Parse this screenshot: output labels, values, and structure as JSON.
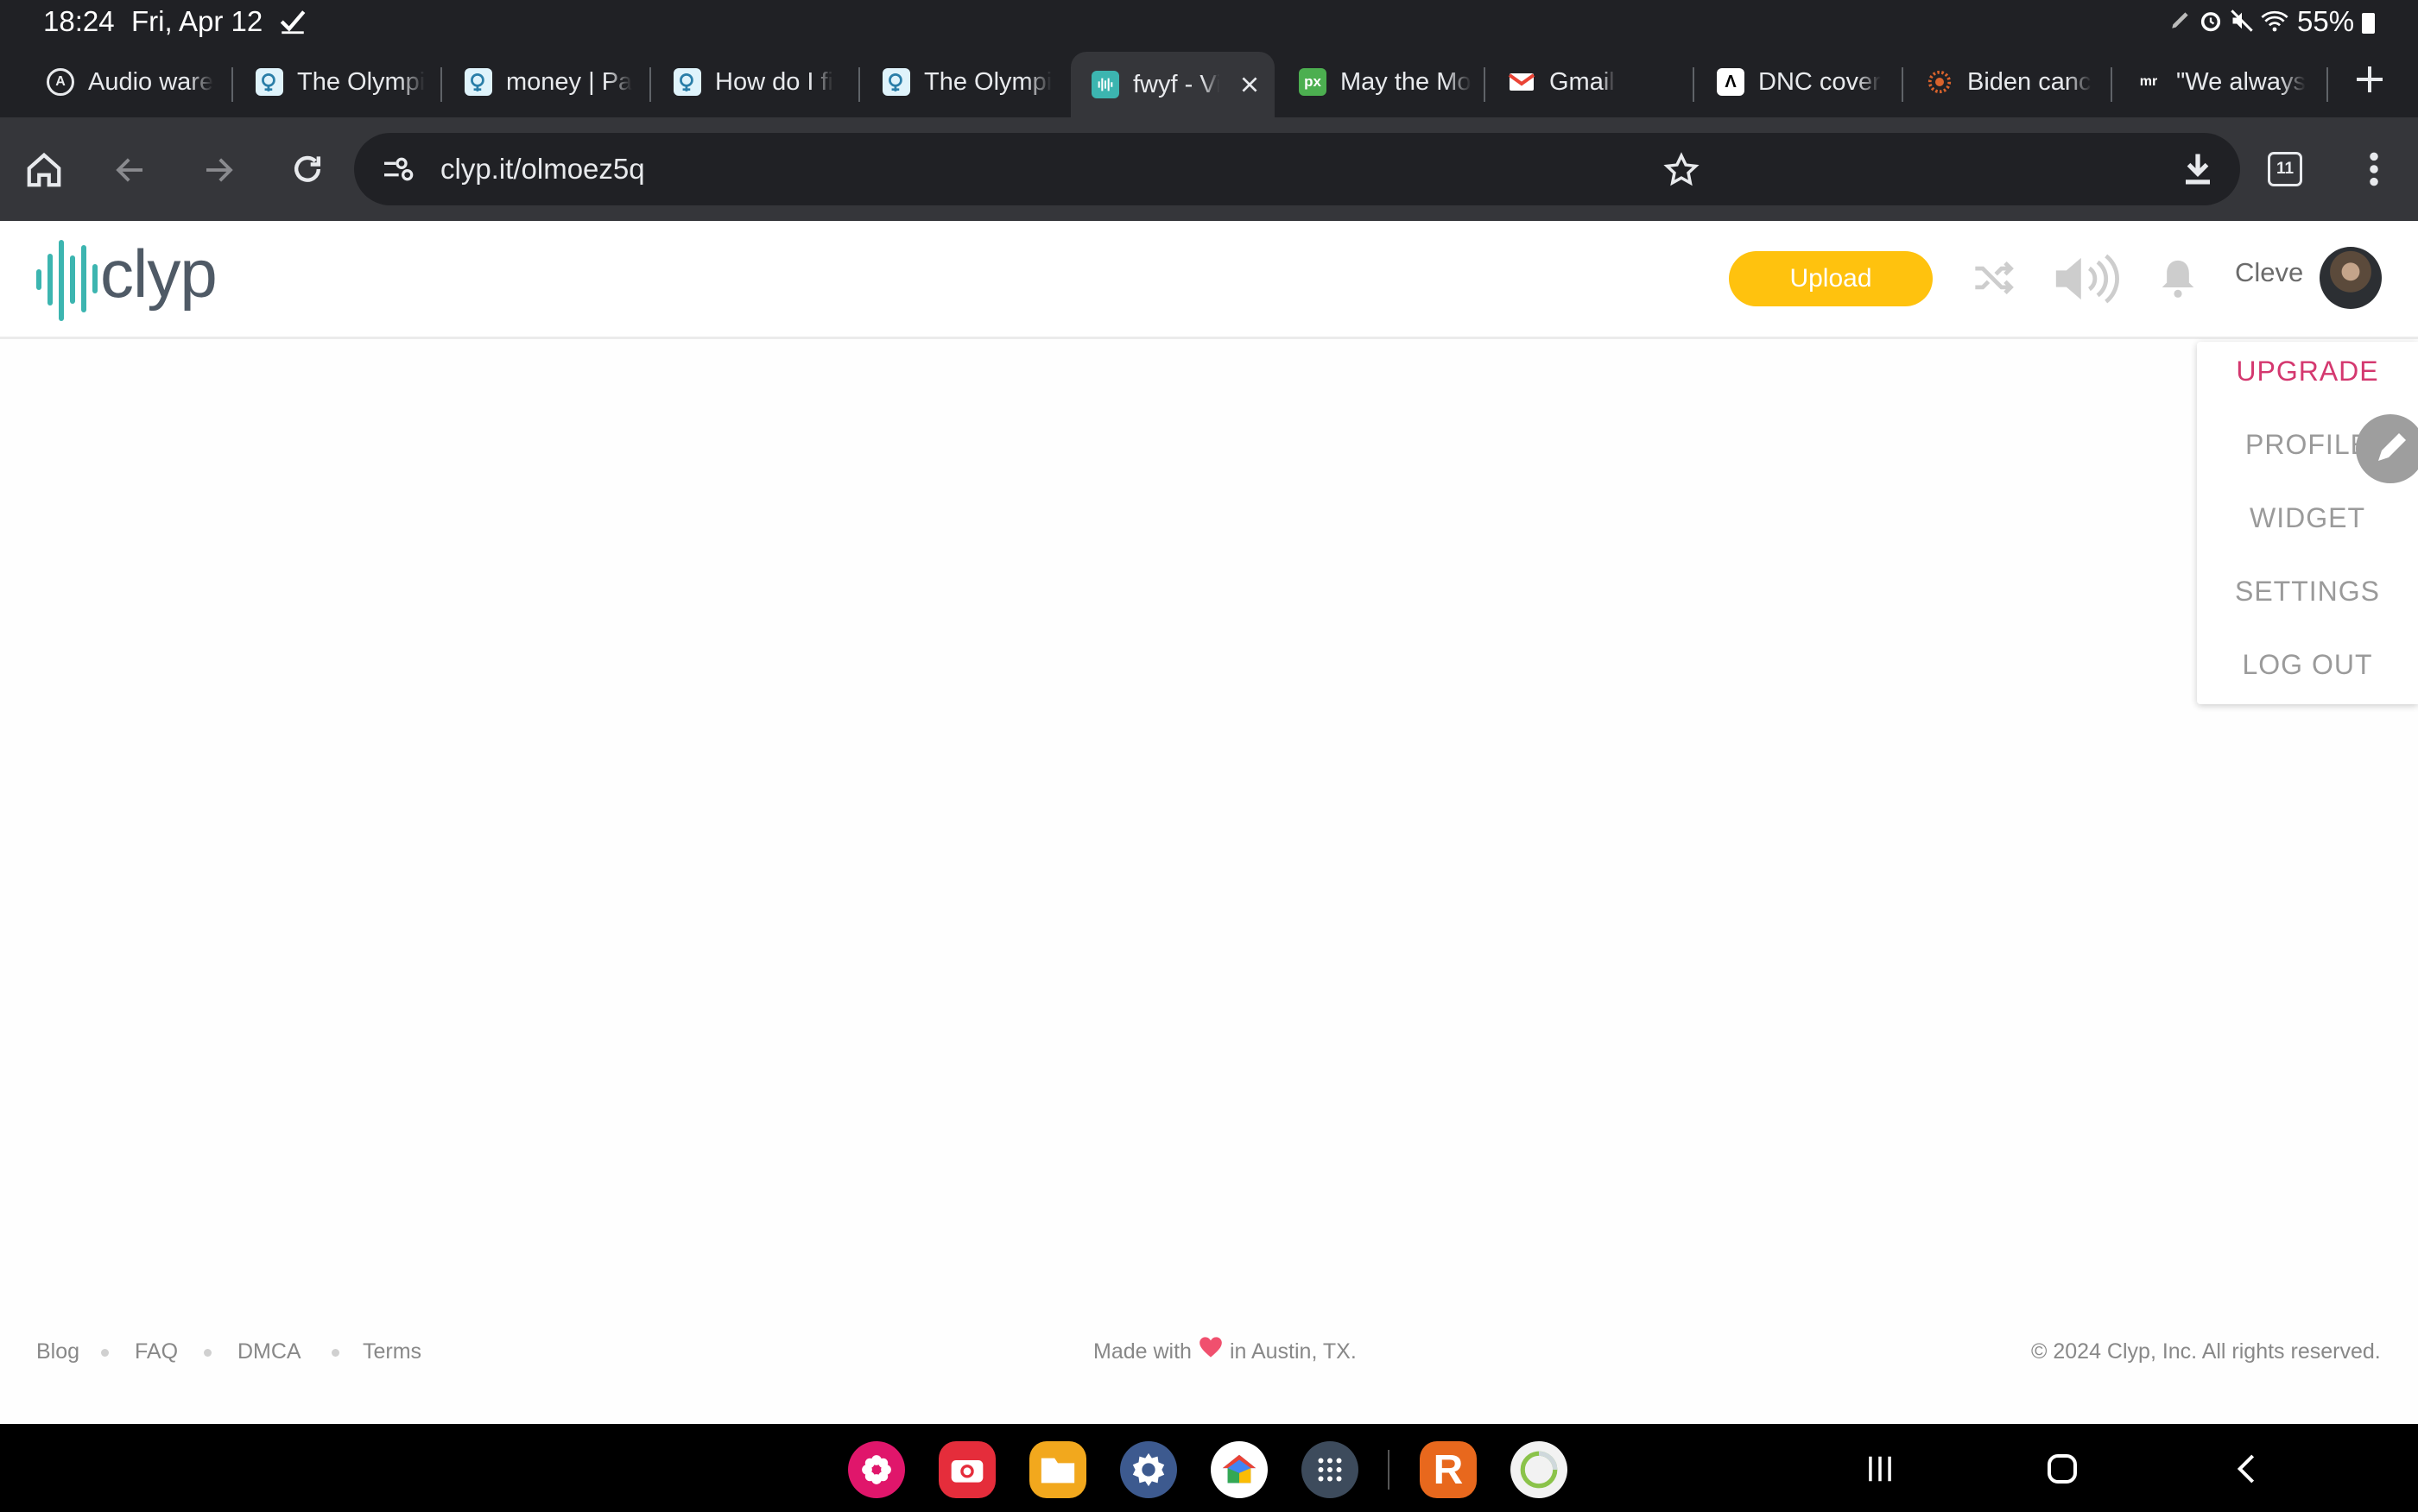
{
  "status": {
    "time": "18:24",
    "date": "Fri, Apr 12",
    "battery": "55%"
  },
  "tabs": [
    {
      "title": "Audio ware",
      "icon": "audio-app-icon",
      "active": false
    },
    {
      "title": "The Olympi",
      "icon": "olympia-favicon",
      "active": false
    },
    {
      "title": "money | Pa",
      "icon": "olympia-favicon",
      "active": false
    },
    {
      "title": "How do I fi",
      "icon": "olympia-favicon",
      "active": false
    },
    {
      "title": "The Olympi",
      "icon": "olympia-favicon",
      "active": false
    },
    {
      "title": "fwyf - Vi",
      "icon": "clyp-favicon",
      "active": true
    },
    {
      "title": "May the Mo",
      "icon": "px-favicon",
      "active": false
    },
    {
      "title": "Gmail",
      "icon": "gmail-icon",
      "active": false
    },
    {
      "title": "DNC cover",
      "icon": "news-favicon",
      "active": false
    },
    {
      "title": "Biden canc",
      "icon": "sun-favicon",
      "active": false
    },
    {
      "title": "\"We always",
      "icon": "mr-favicon",
      "active": false
    }
  ],
  "toolbar": {
    "url": "clyp.it/olmoez5q",
    "tab_count": "11"
  },
  "header": {
    "logo_text": "clyp",
    "upload_label": "Upload",
    "username": "Cleve"
  },
  "menu": {
    "items": [
      "UPGRADE",
      "PROFILE",
      "WIDGET",
      "SETTINGS",
      "LOG OUT"
    ]
  },
  "footer": {
    "links": [
      "Blog",
      "FAQ",
      "DMCA",
      "Terms"
    ],
    "made_with_prefix": "Made with",
    "made_with_suffix": "in Austin, TX.",
    "copyright": "© 2024 Clyp, Inc. All rights reserved."
  },
  "colors": {
    "brand_teal": "#3cb5b0",
    "upload_yellow": "#ffc20e",
    "upgrade_pink": "#d4386f",
    "heart": "#f0506e"
  }
}
